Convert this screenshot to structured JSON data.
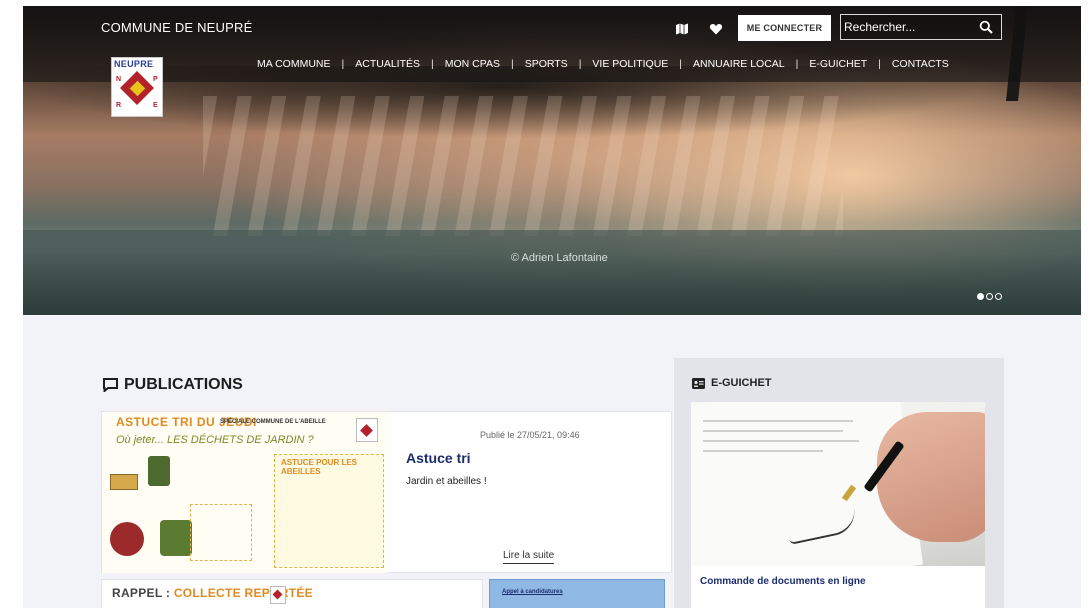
{
  "header": {
    "brand": "COMMUNE DE NEUPRÉ",
    "login_label": "ME CONNECTER",
    "search_placeholder": "Rechercher...",
    "nav": [
      "MA COMMUNE",
      "ACTUALITÉS",
      "MON CPAS",
      "SPORTS",
      "VIE POLITIQUE",
      "ANNUAIRE LOCAL",
      "E-GUICHET",
      "CONTACTS"
    ],
    "nav_separator": "|",
    "logo": {
      "text": "NEUPRE",
      "letters": [
        "N",
        "P",
        "R",
        "E"
      ]
    }
  },
  "hero": {
    "credit": "© Adrien Lafontaine",
    "slides": [
      true,
      false,
      false
    ]
  },
  "publications": {
    "title": "PUBLICATIONS",
    "featured": {
      "date": "Publié le 27/05/21, 09:46",
      "title": "Astuce tri",
      "description": "Jardin et abeilles !",
      "read_more": "Lire la suite",
      "poster": {
        "heading": "ASTUCE TRI DU JEUDI",
        "tagline": "SPÉCIALE COMMUNE DE L'ABEILLE",
        "subheading": "Où jeter... LES DÉCHETS DE JARDIN ?",
        "box_title": "ASTUCE POUR LES ABEILLES"
      }
    },
    "second": {
      "prefix": "RAPPEL :",
      "title": "COLLECTE REPORTÉE"
    },
    "third": {
      "title": "Appel à candidatures"
    }
  },
  "sidebar": {
    "title": "E-GUICHET",
    "link": "Commande de documents en ligne"
  },
  "colors": {
    "accent": "#1c2d6e",
    "brand_red": "#b3222a",
    "poster_orange": "#e08b22"
  }
}
